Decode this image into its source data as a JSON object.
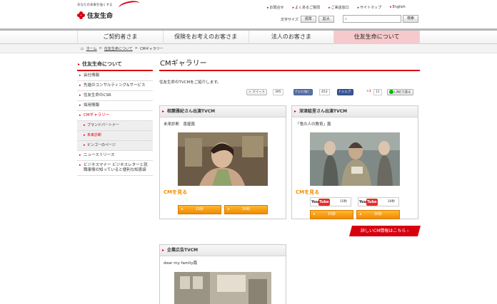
{
  "header": {
    "tagline": "あなたの未来を強くする",
    "brand": "住友生命",
    "util_links": [
      "お問合せ",
      "よくあるご質問",
      "ご来店窓口",
      "サイトマップ",
      "English"
    ],
    "font_size_label": "文字サイズ",
    "font_size_options": [
      "標準",
      "拡大"
    ],
    "search_placeholder": "",
    "search_button": "検索"
  },
  "nav": {
    "items": [
      "ご契約者さま",
      "保険をお考えのお客さま",
      "法人のお客さま",
      "住友生命について"
    ],
    "active_index": 3
  },
  "breadcrumb": [
    "ホーム",
    "住友生命について",
    "CMギャラリー"
  ],
  "sidebar": {
    "title": "住友生命について",
    "items": [
      {
        "label": "会社情報",
        "level": 1,
        "current": false
      },
      {
        "label": "先進のコンサルティング&サービス",
        "level": 1,
        "current": false
      },
      {
        "label": "住友生命のCSR",
        "level": 1,
        "current": false
      },
      {
        "label": "採用情報",
        "level": 1,
        "current": false
      },
      {
        "label": "CMギャラリー",
        "level": 1,
        "current": true
      },
      {
        "label": "ブランドパートナー",
        "level": 2,
        "current": false
      },
      {
        "label": "未来診断",
        "level": 2,
        "current": true
      },
      {
        "label": "ビンゴーのページ",
        "level": 2,
        "current": false
      },
      {
        "label": "ニュースリリース",
        "level": 1,
        "current": false
      },
      {
        "label": "ビジネスマナー ビジネスレターと就職事情の知っていると便利な知恵袋",
        "level": 1,
        "current": false
      }
    ]
  },
  "main": {
    "title": "CMギャラリー",
    "intro": "住友生命のTVCMをご紹介します。",
    "social": {
      "tweet": "ツイート",
      "tweet_count": "395",
      "like": "いいね！",
      "like_count": "453",
      "share": "シェア",
      "gplus": "+1",
      "gplus_count": "11",
      "line": "LINEで送る"
    },
    "cards": [
      {
        "heading": "相葉雅紀さん出演TVCM",
        "subtitle": "未来診断　喜屋篇",
        "link": "CMを見る",
        "buttons": [
          "15秒",
          "30秒"
        ]
      },
      {
        "heading": "深津絵里さん出演TVCM",
        "subtitle": "「鬼の人の教育」篇",
        "link": "CMを見る",
        "youtube_labels": [
          "15秒",
          "30秒"
        ],
        "youtube_text": "You Tube",
        "buttons": [
          "15秒",
          "30秒"
        ]
      },
      {
        "heading": "企業広告TVCM",
        "subtitle": "dear my family篇"
      }
    ],
    "details_button": "詳しいCM情報はこちら"
  },
  "colors": {
    "brand_red": "#d7000f",
    "orange": "#f08a00",
    "nav_active_bg": "#f6c9cc"
  }
}
